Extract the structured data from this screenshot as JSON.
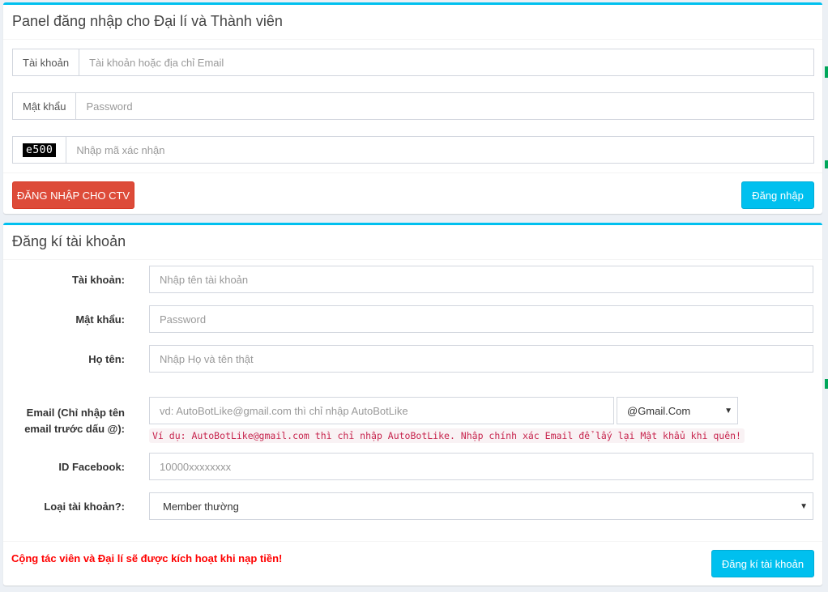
{
  "login": {
    "title": "Panel đăng nhập cho Đại lí và Thành viên",
    "username_label": "Tài khoản",
    "username_placeholder": "Tài khoản hoặc địa chỉ Email",
    "password_label": "Mật khẩu",
    "password_placeholder": "Password",
    "captcha_code": "e500",
    "captcha_placeholder": "Nhập mã xác nhận",
    "ctv_button": "ĐĂNG NHẬP CHO CTV",
    "login_button": "Đăng nhập"
  },
  "register": {
    "title": "Đăng kí tài khoản",
    "username_label": "Tài khoản:",
    "username_placeholder": "Nhập tên tài khoản",
    "password_label": "Mật khẩu:",
    "password_placeholder": "Password",
    "fullname_label": "Họ tên:",
    "fullname_placeholder": "Nhập Họ và tên thật",
    "email_label_line1": "Email (Chỉ nhập tên",
    "email_label_line2": "email trước dấu @):",
    "email_placeholder": "vd: AutoBotLike@gmail.com thì chỉ nhập AutoBotLike",
    "email_domain_selected": "@Gmail.Com",
    "email_hint": "Ví dụ: AutoBotLike@gmail.com thì chỉ nhập AutoBotLike. Nhập chính xác Email để lấy lại Mật khẩu khi quên!",
    "facebook_label": "ID Facebook:",
    "facebook_placeholder": "10000xxxxxxxx",
    "account_type_label": "Loại tài khoản?:",
    "account_type_selected": "Member thường",
    "notice": "Cộng tác viên và Đại lí sẽ được kích hoạt khi nạp tiền!",
    "register_button": "Đăng kí tài khoản"
  },
  "icons": {
    "caret": "▼"
  },
  "colors": {
    "accent": "#00c0ef",
    "danger": "#dd4b39",
    "notice": "#ff0000",
    "hint_text": "#c7254e"
  }
}
